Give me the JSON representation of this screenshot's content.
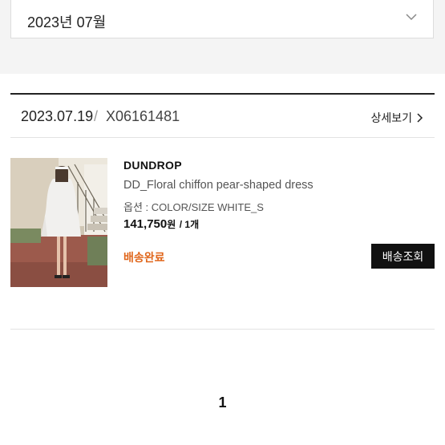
{
  "filter": {
    "month": "2023년 07월",
    "icon": "chevron-down-icon"
  },
  "order": {
    "date": "2023.07.19",
    "separator": "/",
    "number": "X06161481",
    "detail_link": "상세보기",
    "detail_icon": "chevron-right-icon"
  },
  "item": {
    "brand": "DUNDROP",
    "name": "DD_Floral chiffon pear-shaped dress",
    "option": "옵션 : COLOR/SIZE WHITE_S",
    "price": "141,750",
    "price_unit": "원",
    "quantity": "/ 1개",
    "status": "배송완료",
    "track_button": "배송조회"
  },
  "pagination": {
    "current": "1"
  },
  "colors": {
    "accent_status": "#e0661b",
    "button_bg": "#111111",
    "page_bg": "#f4f4f4"
  }
}
